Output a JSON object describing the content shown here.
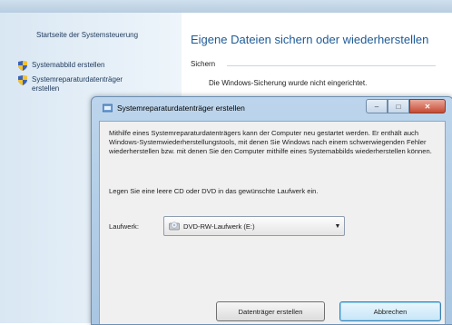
{
  "nav": {
    "home": "Startseite der Systemsteuerung",
    "items": [
      {
        "label": "Systemabbild erstellen"
      },
      {
        "label": "Systemreparaturdatenträger erstellen"
      }
    ]
  },
  "main": {
    "title": "Eigene Dateien sichern oder wiederherstellen",
    "section": "Sichern",
    "status": "Die Windows-Sicherung wurde nicht eingerichtet."
  },
  "dialog": {
    "title": "Systemreparaturdatenträger erstellen",
    "description": "Mithilfe eines Systemreparaturdatenträgers kann der Computer neu gestartet werden. Er enthält auch Windows-Systemwiederherstellungstools, mit denen Sie Windows nach einem schwerwiegenden Fehler wiederherstellen bzw. mit denen Sie den Computer mithilfe eines Systemabbilds wiederherstellen können.",
    "prompt": "Legen Sie eine leere CD oder DVD in das gewünschte Laufwerk ein.",
    "drive_label": "Laufwerk:",
    "drive_value": "DVD-RW-Laufwerk (E:)",
    "create_button": "Datenträger erstellen",
    "cancel_button": "Abbrechen",
    "minimize_glyph": "–",
    "maximize_glyph": "□",
    "close_glyph": "✕"
  },
  "icons": [
    "shield-icon",
    "dialog-app-icon",
    "disc-drive-icon",
    "chevron-down-icon"
  ],
  "colors": {
    "accent": "#1e5a96",
    "nav_link": "#1e395b",
    "close_red": "#c74a34"
  }
}
